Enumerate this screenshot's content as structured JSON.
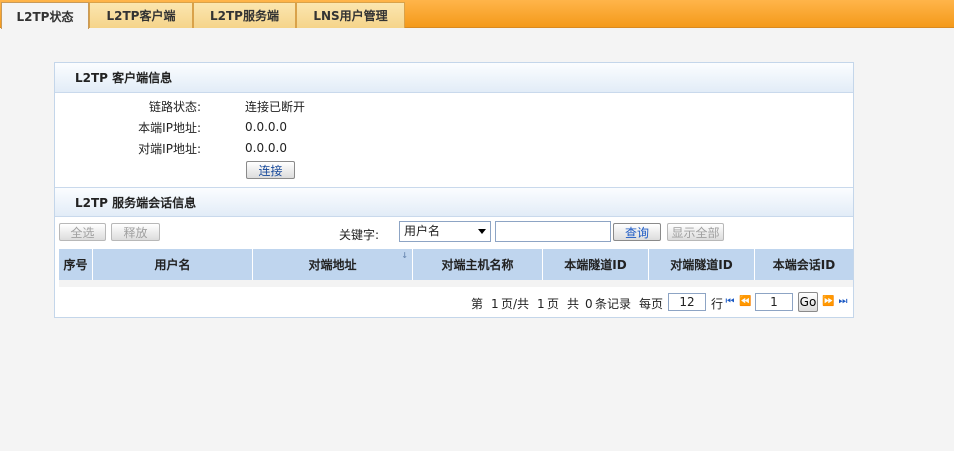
{
  "tabs": [
    {
      "label": "L2TP状态"
    },
    {
      "label": "L2TP客户端"
    },
    {
      "label": "L2TP服务端"
    },
    {
      "label": "LNS用户管理"
    }
  ],
  "client_info": {
    "title": "L2TP 客户端信息",
    "link_status_label": "链路状态:",
    "link_status_value": "连接已断开",
    "local_ip_label": "本端IP地址:",
    "local_ip_value": "0.0.0.0",
    "peer_ip_label": "对端IP地址:",
    "peer_ip_value": "0.0.0.0",
    "connect_button": "连接"
  },
  "server_sessions": {
    "title": "L2TP 服务端会话信息",
    "select_all_button": "全选",
    "release_button": "释放",
    "keyword_label": "关键字:",
    "keyword_select_value": "用户名",
    "search_value": "",
    "query_button": "查询",
    "show_all_button": "显示全部",
    "columns": [
      "序号",
      "用户名",
      "对端地址",
      "对端主机名称",
      "本端隧道ID",
      "对端隧道ID",
      "本端会话ID"
    ]
  },
  "pager": {
    "page_prefix": "第",
    "current_page": "1",
    "page_mid": "页/共",
    "total_pages": "1",
    "page_suffix": "页",
    "total_prefix": "共",
    "total_records": "0",
    "records_suffix": "条记录",
    "per_page_label": "每页",
    "per_page_value": "12",
    "rows_label": "行",
    "goto_value": "1",
    "go_button": "Go"
  }
}
